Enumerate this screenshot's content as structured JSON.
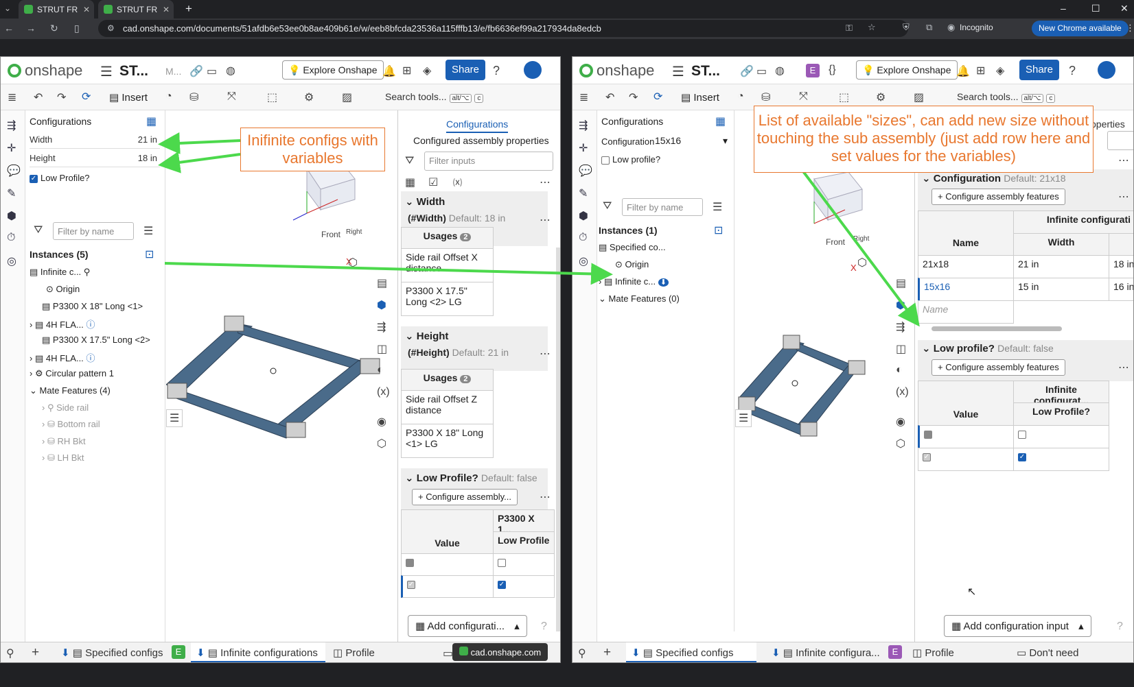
{
  "browser": {
    "tabs": [
      {
        "label": "STRUT FR"
      },
      {
        "label": "STRUT FR"
      }
    ],
    "new_tab": "+",
    "url": "cad.onshape.com/documents/51afdb6e53ee0b8ae409b61e/w/eeb8bfcda23536a115fffb13/e/fb6636ef99a217934da8edcb",
    "incognito": "Incognito",
    "new_chrome": "New Chrome available"
  },
  "left": {
    "brand": "onshape",
    "doc": "ST...",
    "doc_extra": "M...",
    "badge": "E",
    "badge_color": "#3fae49",
    "explore": "Explore Onshape",
    "share": "Share",
    "insert": "Insert",
    "search_tools": "Search tools...",
    "kbd1": "alt/⌥",
    "kbd2": "c",
    "config_panel": {
      "title": "Configurations",
      "width_label": "Width",
      "width_value": "21 in",
      "height_label": "Height",
      "height_value": "18 in",
      "low_profile": "Low Profile?"
    },
    "filter_placeholder": "Filter by name",
    "instances_title": "Instances (5)",
    "tree": [
      "Infinite c...",
      "Origin",
      "P3300 X 18\" Long <1>",
      "4H FLA...",
      "P3300 X 17.5\" Long <2>",
      "4H FLA...",
      "Circular pattern 1",
      "Mate Features (4)",
      "Side rail",
      "Bottom rail",
      "RH Bkt",
      "LH Bkt"
    ],
    "right_panel": {
      "tab": "Configurations",
      "subtitle": "Configured assembly properties",
      "filter_placeholder": "Filter inputs",
      "width_title": "Width",
      "width_id": "(#Width)",
      "width_default": "Default: 18 in",
      "usages": "Usages",
      "usages_count": "2",
      "width_usage1": "Side rail Offset X distance",
      "width_usage2": "P3300 X 17.5\" Long <2> LG",
      "height_title": "Height",
      "height_id": "(#Height)",
      "height_default": "Default: 21 in",
      "height_usage1": "Side rail Offset Z distance",
      "height_usage2": "P3300 X 18\" Long <1> LG",
      "low_title": "Low Profile?",
      "low_default": "Default: false",
      "configure_btn": "Configure assembly...",
      "value_head": "Value",
      "col_head": "P3300 X 1...",
      "col_sub": "Low Profile",
      "add_cfg": "Add configurati..."
    },
    "bottom_tabs": [
      "Specified configs",
      "E",
      "Infinite configurations",
      "Profile"
    ],
    "tooltip": "cad.onshape.com",
    "cube_front": "Front",
    "cube_right": "Right",
    "axis_x": "X"
  },
  "right": {
    "brand": "onshape",
    "doc": "ST...",
    "badge": "E",
    "badge_color": "#9b59b6",
    "explore": "Explore Onshape",
    "share": "Share",
    "insert": "Insert",
    "search_tools": "Search tools...",
    "kbd1": "alt/⌥",
    "kbd2": "c",
    "config_panel": {
      "title": "Configurations",
      "config_label": "Configuration",
      "config_value": "15x16",
      "low_profile": "Low profile?"
    },
    "filter_placeholder": "Filter by name",
    "instances_title": "Instances (1)",
    "tree": [
      "Specified co...",
      "Origin",
      "Infinite c...",
      "Mate Features (0)"
    ],
    "right_panel": {
      "tab_partial": "operties",
      "config_title": "Configuration",
      "config_default": "Default: 21x18",
      "configure_btn": "Configure assembly features",
      "group_head": "Infinite configurati",
      "name_head": "Name",
      "width_head": "Width",
      "rows": [
        {
          "name": "21x18",
          "width": "21 in",
          "height": "18 in"
        },
        {
          "name": "15x16",
          "width": "15 in",
          "height": "16 in"
        }
      ],
      "name_placeholder": "Name",
      "low_title": "Low profile?",
      "low_default": "Default: false",
      "configure_btn2": "Configure assembly features",
      "group_head2": "Infinite configurat...",
      "value_head": "Value",
      "low_head": "Low Profile?",
      "add_cfg": "Add configuration input"
    },
    "bottom_tabs": [
      "Specified configs",
      "Infinite configura...",
      "E",
      "Profile",
      "Don't need"
    ],
    "cube_front": "Front",
    "cube_right": "Right",
    "axis_x": "X"
  },
  "callouts": {
    "left": "Inifinite configs with variables",
    "right": "List of available \"sizes\", can add new size without touching the sub assembly (just add row here and set values for the variables)"
  },
  "colors": {
    "accent": "#1a5fb4",
    "callout": "#e8772e",
    "arrow": "#4cd94c"
  }
}
